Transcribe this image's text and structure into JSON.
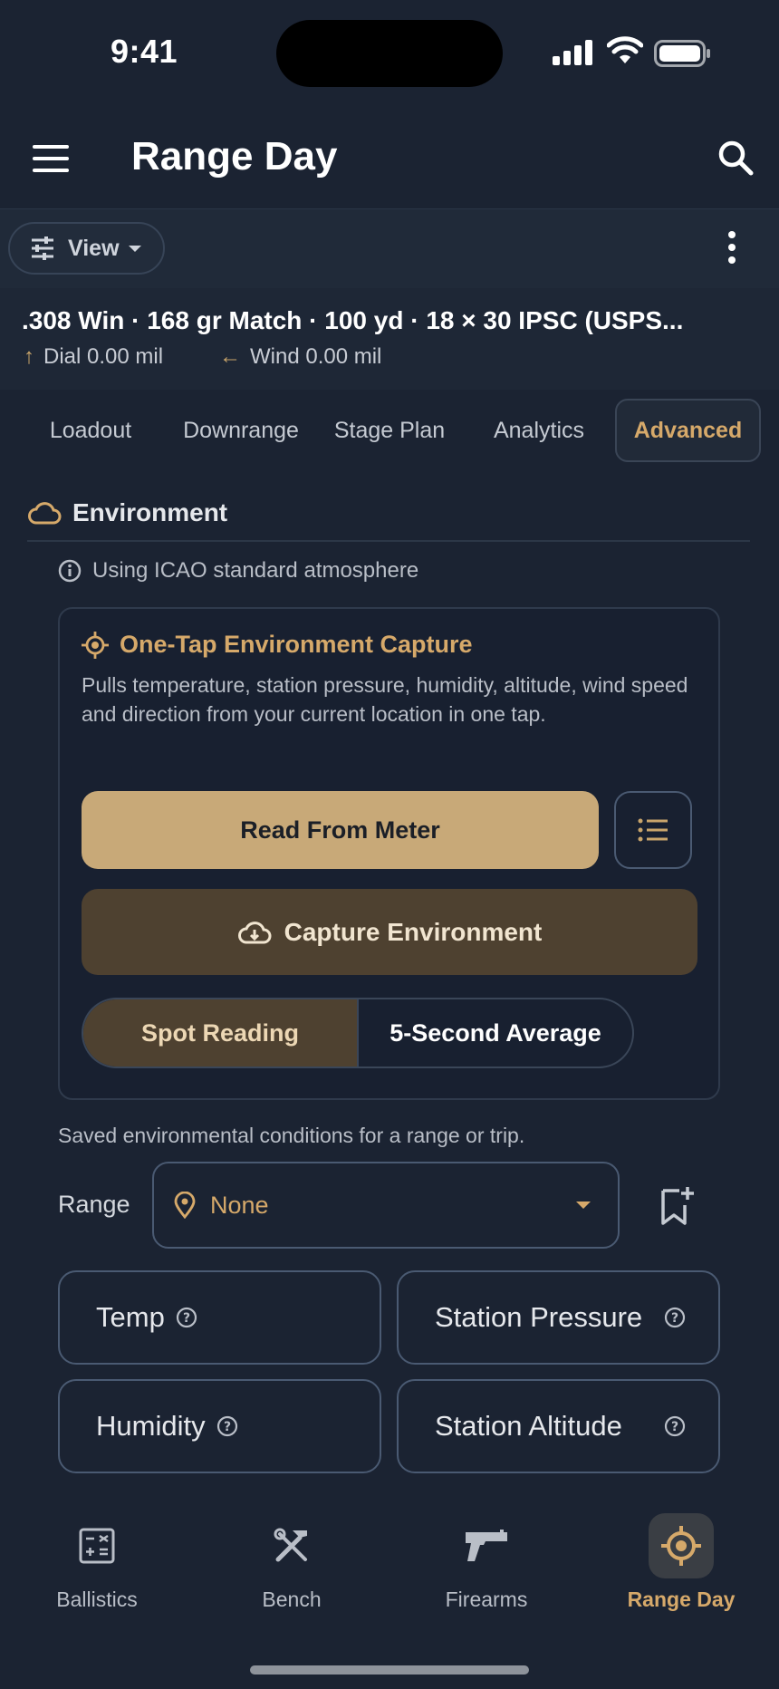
{
  "status": {
    "time": "9:41"
  },
  "appbar": {
    "title": "Range Day"
  },
  "toolbar": {
    "view_label": "View"
  },
  "summary": {
    "title": ".308 Win · 168 gr Match · 100 yd · 18 × 30 IPSC (USPS...",
    "dial": "Dial 0.00 mil",
    "wind": "Wind 0.00 mil"
  },
  "tabs": [
    {
      "label": "Loadout"
    },
    {
      "label": "Downrange"
    },
    {
      "label": "Stage Plan"
    },
    {
      "label": "Analytics"
    },
    {
      "label": "Advanced",
      "active": true
    }
  ],
  "environment": {
    "heading": "Environment",
    "info": "Using ICAO standard atmosphere",
    "card": {
      "title": "One-Tap Environment Capture",
      "description": "Pulls temperature, station pressure, humidity, altitude, wind speed and direction from your current location in one tap.",
      "read_button": "Read From Meter",
      "capture_button": "Capture Environment",
      "mode_spot": "Spot Reading",
      "mode_average": "5-Second Average",
      "selected_mode": "Spot Reading"
    },
    "saved_note": "Saved environmental conditions for a range or trip.",
    "range_label": "Range",
    "range_value": "None",
    "fields": {
      "temp": "Temp",
      "station_pressure": "Station Pressure",
      "humidity": "Humidity",
      "station_altitude": "Station Altitude"
    }
  },
  "nav": [
    {
      "label": "Ballistics"
    },
    {
      "label": "Bench"
    },
    {
      "label": "Firearms"
    },
    {
      "label": "Range Day",
      "active": true
    }
  ],
  "colors": {
    "background": "#1b2332",
    "accent": "#d6a96a",
    "primary_button": "#c8a978",
    "capture_button": "#4e4130"
  }
}
